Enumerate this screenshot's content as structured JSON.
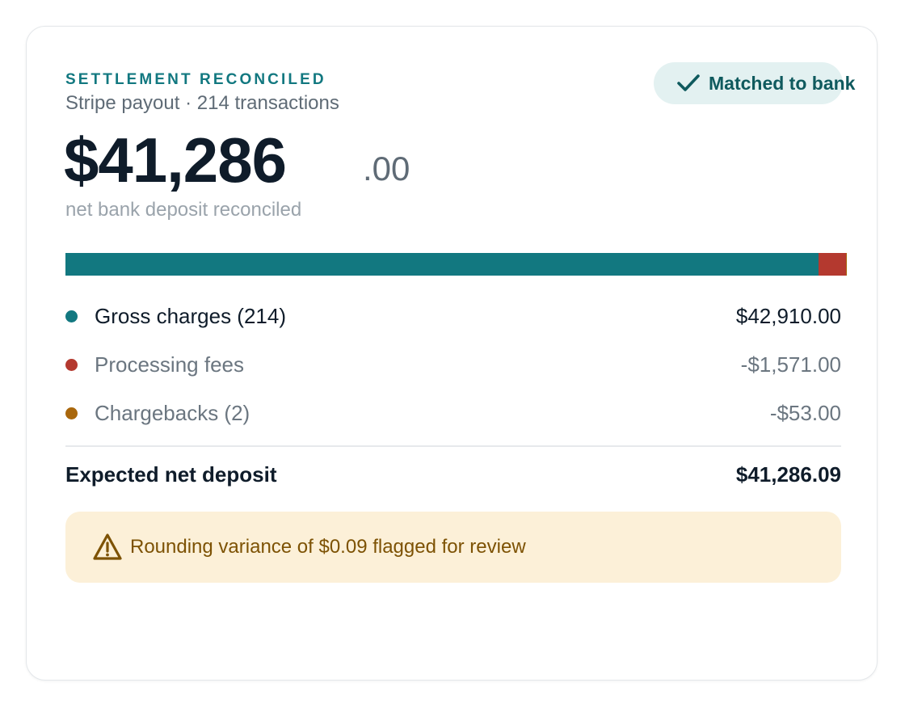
{
  "card": {
    "eyebrow": "SETTLEMENT RECONCILED",
    "subtitle": "Stripe payout · 214 transactions",
    "badge": {
      "icon": "check-icon",
      "label": "Matched to bank"
    },
    "amount": {
      "main": "$41,286",
      "cents": ".00",
      "caption": "net bank deposit reconciled"
    },
    "breakdown_bar": {
      "segments": [
        {
          "name": "Gross charges",
          "value": 42910.0,
          "color": "#127880"
        },
        {
          "name": "Processing fees",
          "value": 1571.0,
          "color": "#b4392f"
        },
        {
          "name": "Chargebacks",
          "value": 53.0,
          "color": "#a9670c"
        }
      ]
    },
    "lines": [
      {
        "label": "Gross charges (214)",
        "value": "$42,910.00",
        "color": "#127880"
      },
      {
        "label": "Processing fees",
        "value": "-$1,571.00",
        "color": "#b4392f"
      },
      {
        "label": "Chargebacks (2)",
        "value": "-$53.00",
        "color": "#a9670c"
      }
    ],
    "total": {
      "label": "Expected net deposit",
      "value": "$41,286.09"
    },
    "alert": {
      "icon": "warning-icon",
      "text": "Rounding variance of $0.09 flagged for review",
      "color": "#7d5204"
    }
  }
}
